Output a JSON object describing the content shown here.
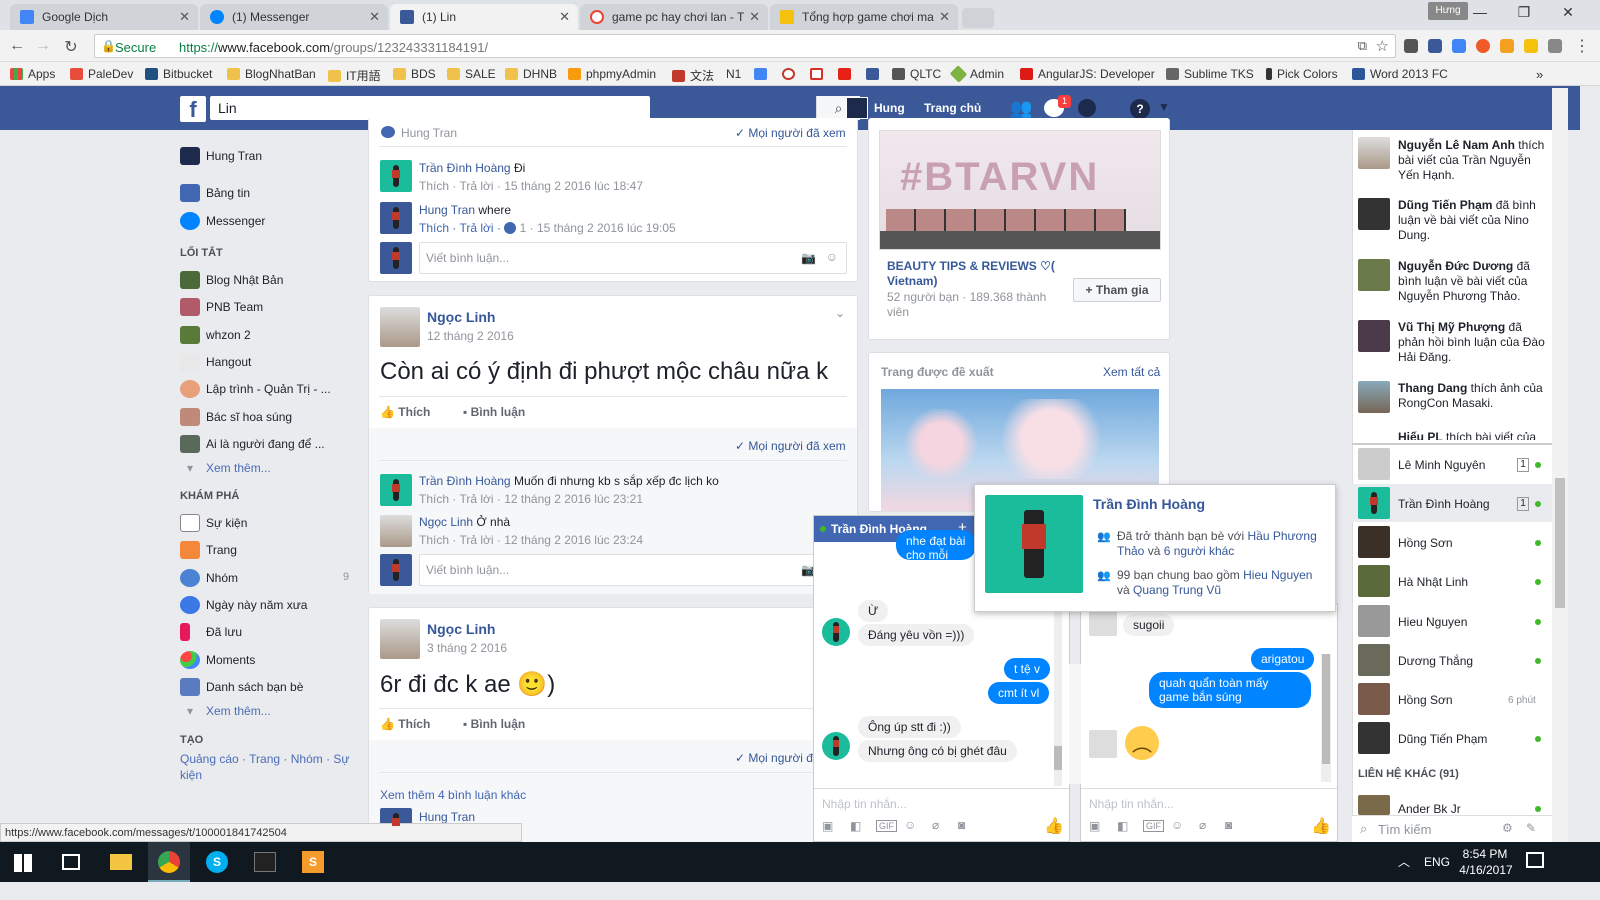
{
  "browser": {
    "tabs": [
      {
        "title": "Google Dịch",
        "color": "#4285f4"
      },
      {
        "title": "(1) Messenger",
        "color": "#0084ff"
      },
      {
        "title": "(1) Lin",
        "color": "#3b5998"
      },
      {
        "title": "game pc hay chơi lan - T",
        "color": "#ea4335"
      },
      {
        "title": "Tổng hợp game chơi ma",
        "color": "#f4c20d"
      }
    ],
    "user_badge": "Hưng",
    "secure_label": "Secure",
    "url_scheme": "https://",
    "url_host": "www.facebook.com",
    "url_path": "/groups/123243331184191/",
    "bookmarks": [
      "Apps",
      "PaleDev",
      "Bitbucket",
      "BlogNhatBan",
      "IT用語",
      "BDS",
      "SALE",
      "DHNB",
      "phpmyAdmin",
      "文法",
      "N1",
      "",
      "",
      "",
      "",
      "",
      "QLTC",
      "Admin",
      "AngularJS: Developer",
      "Sublime TKS",
      "Pick Colors",
      "Word 2013 FC"
    ],
    "status_url": "https://www.facebook.com/messages/t/100001841742504"
  },
  "fb_header": {
    "search_value": "Lin",
    "user": "Hung",
    "home": "Trang chủ",
    "notif_count": "1"
  },
  "left_nav": {
    "user": "Hung Tran",
    "items": [
      "Bảng tin",
      "Messenger"
    ],
    "shortcuts_title": "LỐI TẮT",
    "shortcuts": [
      "Blog Nhật Bản",
      "PNB Team",
      "whzon 2",
      "Hangout",
      "Lập trình - Quản Trị - ...",
      "Bác sĩ hoa súng",
      "Ai là người đang để ..."
    ],
    "see_more": "Xem thêm...",
    "explore_title": "KHÁM PHÁ",
    "explore": [
      "Sự kiện",
      "Trang",
      "Nhóm",
      "Ngày này năm xưa",
      "Đã lưu",
      "Moments",
      "Danh sách bạn bè"
    ],
    "groups_count": "9",
    "see_more2": "Xem thêm...",
    "create_title": "TẠO",
    "create_links": "Quảng cáo · Trang · Nhóm · Sự kiện"
  },
  "feed": {
    "top_seen_name": "Hung Tran",
    "seen_all": "Mọi người đã xem",
    "c1": {
      "name": "Trần Đình Hoàng",
      "text": "Đi",
      "meta": "Thích · Trả lời · 15 tháng 2 2016 lúc 18:47"
    },
    "c2": {
      "name": "Hung Tran",
      "text": "where",
      "meta_a": "Thích · Trả lời ·",
      "likes": "1",
      "meta_b": "· 15 tháng 2 2016 lúc 19:05"
    },
    "comment_placeholder": "Viết bình luận...",
    "post1": {
      "author": "Ngọc Linh",
      "date": "12 tháng 2 2016",
      "text": "Còn ai có ý định đi phượt mộc châu nữa k",
      "like": "Thích",
      "comment": "Bình luận"
    },
    "c3": {
      "name": "Trần Đình Hoàng",
      "text": "Muốn đi nhưng kb s sắp xếp đc lịch ko",
      "meta": "Thích · Trả lời · 12 tháng 2 2016 lúc 23:21"
    },
    "c4": {
      "name": "Ngọc Linh",
      "text": "Ở nhà",
      "meta": "Thích · Trả lời · 12 tháng 2 2016 lúc 23:24"
    },
    "post2": {
      "author": "Ngọc Linh",
      "date": "3 tháng 2 2016",
      "text": "6r đi đc k ae 🙂)",
      "like": "Thích",
      "comment": "Bình luận"
    },
    "seen_partial": "Mọi người đ",
    "more_comments": "Xem thêm 4 bình luận khác",
    "c5_name": "Hung Tran"
  },
  "right": {
    "group_name": "BEAUTY TIPS & REVIEWS ♡( Vietnam)",
    "group_meta": "52 người bạn · 189.368 thành viên",
    "join": "+ Tham gia",
    "suggested": "Trang được đề xuất",
    "see_all": "Xem tất cả",
    "banner": "#BTARVN"
  },
  "hovercard": {
    "name": "Trần Đình Hoàng",
    "line1_pre": "Đã trở thành bạn bè với ",
    "line1_link": "Hầu Phương Thảo",
    "line1_mid": " và ",
    "line1_link2": "6 người khác",
    "line2_pre": "99 bạn chung bao gồm ",
    "line2_link": "Hieu Nguyen",
    "line2_mid": " và ",
    "line2_link2": "Quang Trung Vũ"
  },
  "chat1": {
    "title": "Trần Đình Hoàng",
    "partial1": "nhe đạt bài",
    "partial2": "cho mỗi người",
    "messages": [
      "Ừ",
      "Đáng yêu vồn =)))",
      "t tệ v",
      "cmt ít vl",
      "Ông úp stt đi :))",
      "Nhưng ông có bị ghét đâu"
    ],
    "input": "Nhập tin nhắn..."
  },
  "chat2": {
    "messages": [
      "sugoii",
      "arigatou",
      "quah quẩn toàn mấy game bắn súng"
    ],
    "input": "Nhập tin nhắn..."
  },
  "ticker": [
    {
      "b": "Nguyễn Lê Nam Anh",
      "t": " thích bài viết của Trần Nguyễn Yến Hạnh."
    },
    {
      "b": "Dũng Tiến Phạm",
      "t": " đã bình luận về bài viết của Nino Dung."
    },
    {
      "b": "Nguyễn Đức Dương",
      "t": " đã bình luận về bài viết của Nguyễn Phương Thảo."
    },
    {
      "b": "Vũ Thị Mỹ Phượng",
      "t": " đã phản hồi bình luận của Đào Hải Đăng."
    },
    {
      "b": "Thang Dang",
      "t": " thích ảnh của RongCon Masaki."
    },
    {
      "b": "Hiếu PL",
      "t": " thích bài viết của"
    }
  ],
  "contacts": [
    {
      "name": "Lê Minh Nguyên",
      "badge": "1"
    },
    {
      "name": "Trần Đình Hoàng",
      "badge": "1"
    },
    {
      "name": "Hồng Sơn"
    },
    {
      "name": "Hà Nhật Linh"
    },
    {
      "name": "Hieu Nguyen"
    },
    {
      "name": "Dương Thắng"
    },
    {
      "name": "Hồng Sơn",
      "time": "6 phút"
    },
    {
      "name": "Dũng Tiến Phạm"
    }
  ],
  "other_contacts": "LIÊN HỆ KHÁC (91)",
  "other_first": "Ander Bk Jr",
  "chat_search": "Tìm kiếm",
  "taskbar": {
    "lang": "ENG",
    "time": "8:54 PM",
    "date": "4/16/2017"
  }
}
